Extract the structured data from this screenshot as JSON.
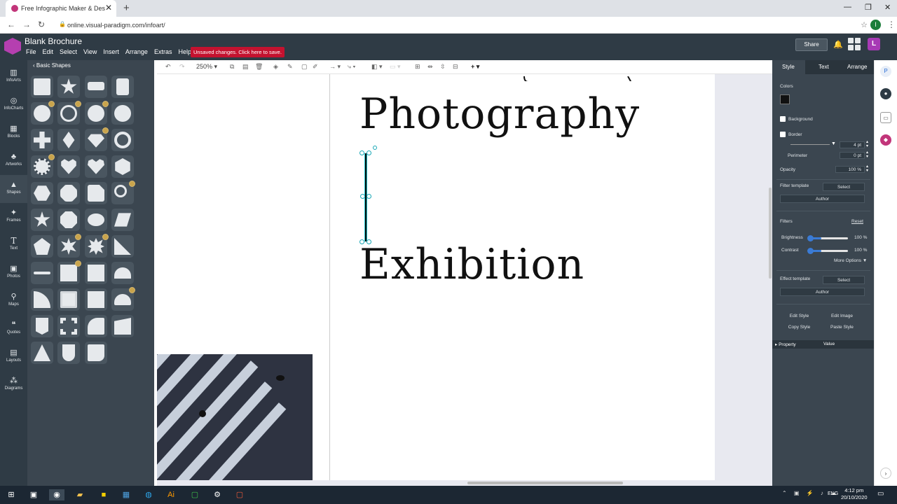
{
  "browser": {
    "tab_title": "Free Infographic Maker & Design",
    "tab_close": "✕",
    "new_tab": "+",
    "url": "online.visual-paradigm.com/infoart/",
    "profile_initial": "I",
    "minimize": "—",
    "maximize": "❐",
    "close": "✕"
  },
  "app": {
    "doc_title": "Blank Brochure",
    "menu": [
      "File",
      "Edit",
      "Select",
      "View",
      "Insert",
      "Arrange",
      "Extras",
      "Help"
    ],
    "unsaved_notice": "Unsaved changes. Click here to save.",
    "share_label": "Share",
    "user_initial": "L"
  },
  "rail": [
    {
      "label": "InfoArts",
      "icon": "infoarts-icon"
    },
    {
      "label": "InfoCharts",
      "icon": "infocharts-icon"
    },
    {
      "label": "Blocks",
      "icon": "blocks-icon"
    },
    {
      "label": "Artworks",
      "icon": "artworks-icon"
    },
    {
      "label": "Shapes",
      "icon": "shapes-icon"
    },
    {
      "label": "Frames",
      "icon": "frames-icon"
    },
    {
      "label": "Text",
      "icon": "text-icon"
    },
    {
      "label": "Photos",
      "icon": "photos-icon"
    },
    {
      "label": "Maps",
      "icon": "maps-icon"
    },
    {
      "label": "Quotes",
      "icon": "quotes-icon"
    },
    {
      "label": "Layouts",
      "icon": "layouts-icon"
    },
    {
      "label": "Diagrams",
      "icon": "diagrams-icon"
    }
  ],
  "shapes_panel": {
    "back_label": "Basic Shapes"
  },
  "toolbar": {
    "zoom": "250%"
  },
  "canvas": {
    "heading1": "Photography",
    "heading2": "Exhibition"
  },
  "style_panel": {
    "tabs": [
      "Style",
      "Text",
      "Arrange"
    ],
    "colors_label": "Colors",
    "background_label": "Background",
    "border_label": "Border",
    "border_width": "4 pt",
    "perimeter_label": "Perimeter",
    "perimeter_value": "0 pt",
    "opacity_label": "Opacity",
    "opacity_value": "100 %",
    "filter_template_label": "Filter template",
    "select_label": "Select",
    "author_label": "Author",
    "filters_label": "Filters",
    "reset_label": "Reset",
    "brightness_label": "Brightness",
    "brightness_value": "100 %",
    "contrast_label": "Contrast",
    "contrast_value": "100 %",
    "more_options_label": "More Options ▼",
    "effect_template_label": "Effect template",
    "edit_style_label": "Edit Style",
    "edit_image_label": "Edit Image",
    "copy_style_label": "Copy Style",
    "paste_style_label": "Paste Style",
    "property_label": "Property",
    "value_label": "Value"
  },
  "taskbar": {
    "lang": "ENG",
    "time": "4:12 pm",
    "date": "20/10/2020"
  },
  "colors": {
    "brand": "#b53fb0",
    "unsaved": "#c4122f",
    "selection": "#18c1c8",
    "panel": "#3b4650"
  }
}
